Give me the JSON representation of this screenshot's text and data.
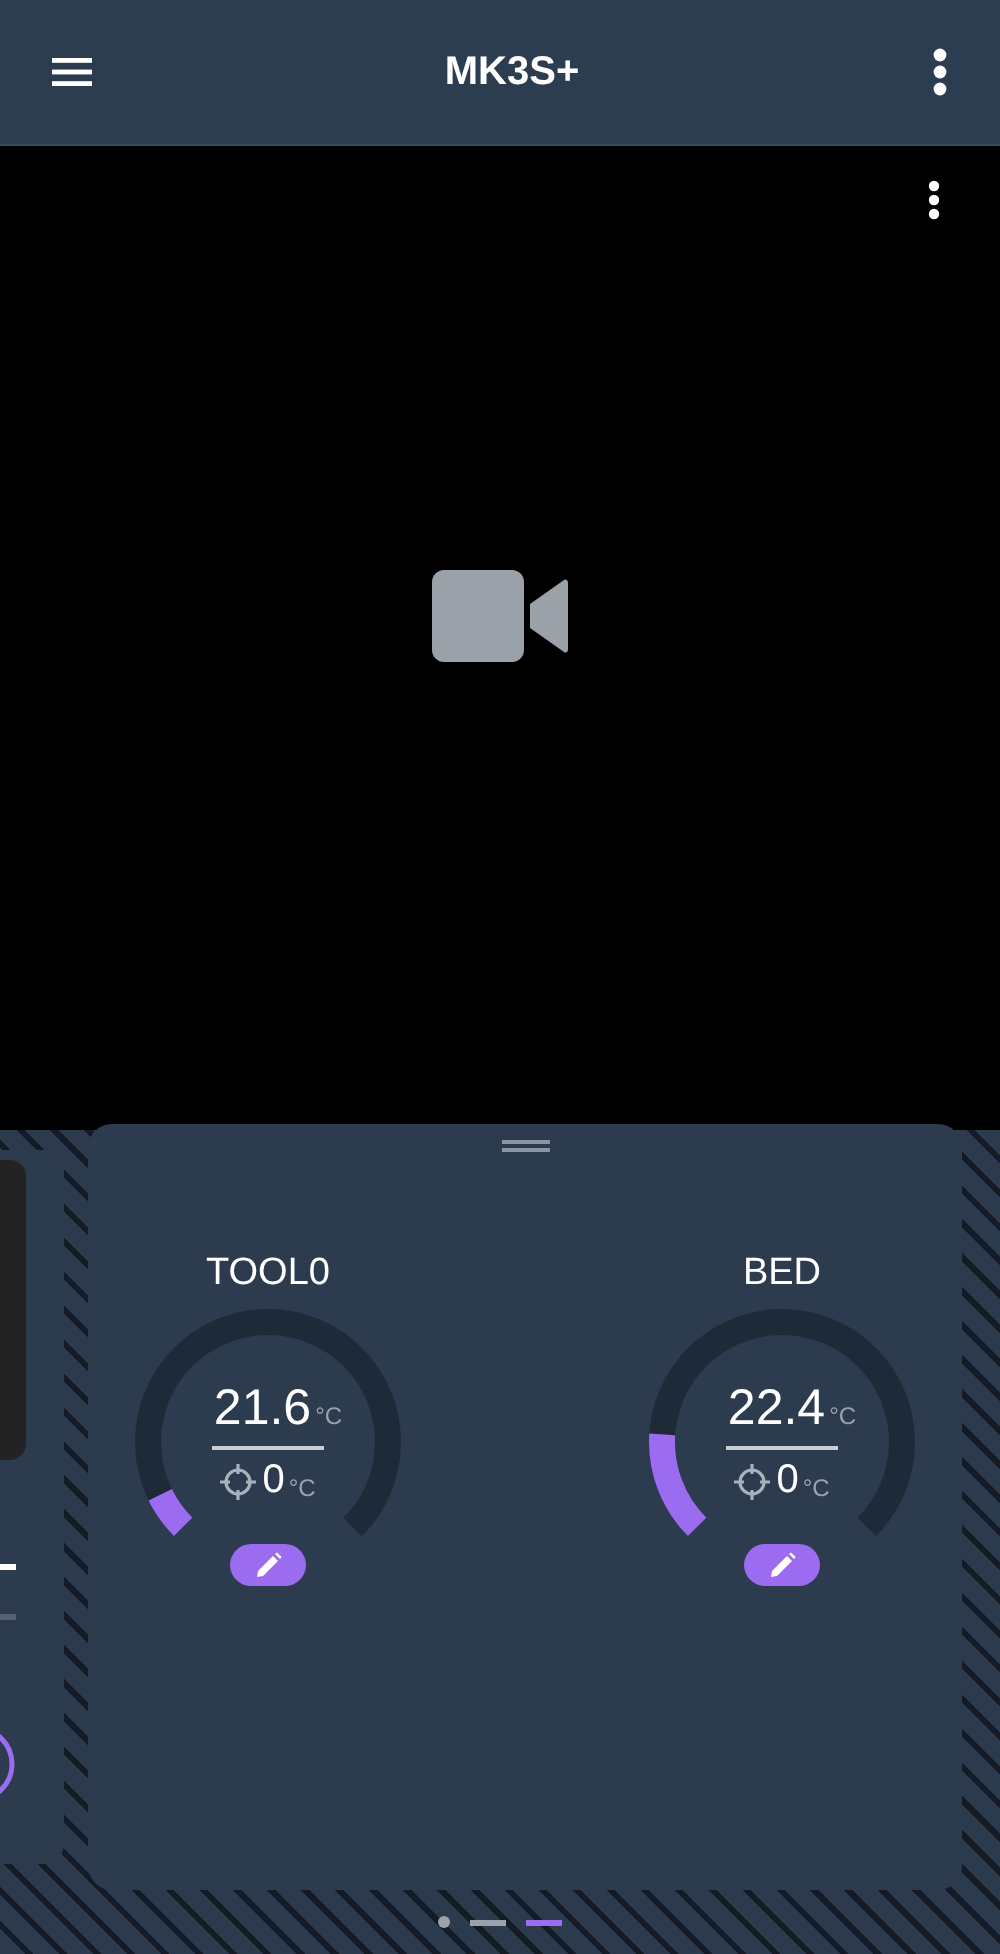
{
  "app_bar": {
    "title": "MK3S+"
  },
  "heaters": [
    {
      "name": "TOOL0",
      "actual": "21.6",
      "unit": "°C",
      "target": "0",
      "target_unit": "°C",
      "level": 0.07
    },
    {
      "name": "BED",
      "actual": "22.4",
      "unit": "°C",
      "target": "0",
      "target_unit": "°C",
      "level": 0.18
    }
  ],
  "pages": [
    {
      "selected": false,
      "kind": "dot"
    },
    {
      "selected": false,
      "kind": "dash"
    },
    {
      "selected": true,
      "kind": "dash"
    }
  ]
}
